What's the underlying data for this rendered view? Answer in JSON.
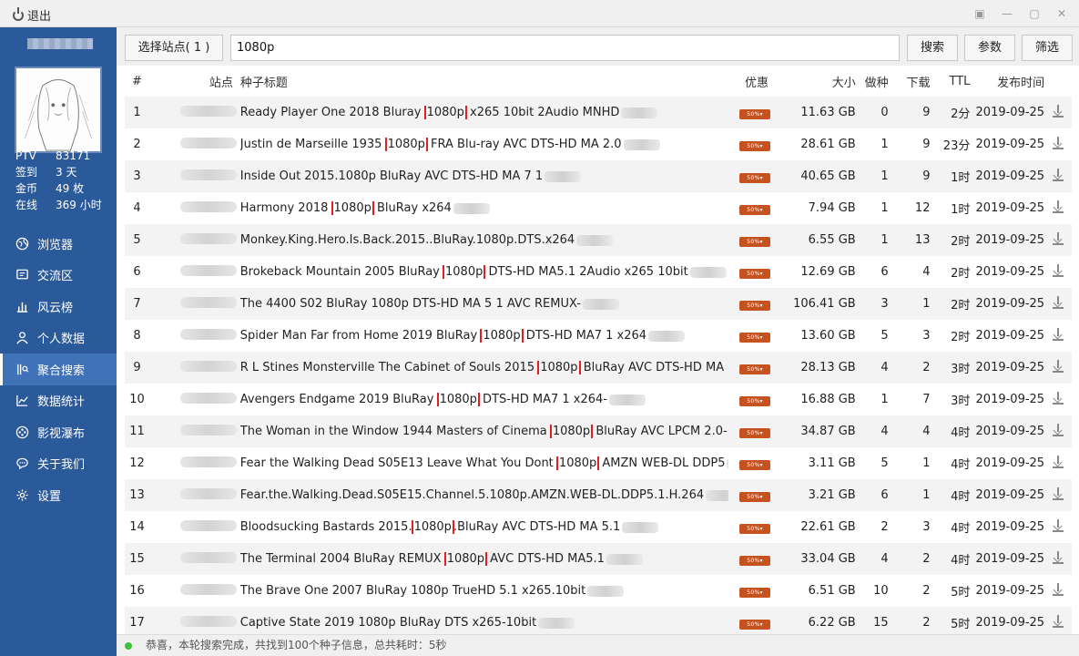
{
  "window": {
    "exit_label": "退出"
  },
  "sidebar": {
    "stats": [
      {
        "key": "PTV",
        "value": "83171"
      },
      {
        "key": "签到",
        "value": "3 天"
      },
      {
        "key": "金币",
        "value": "49 枚"
      },
      {
        "key": "在线",
        "value": "369 小时"
      }
    ],
    "nav": [
      {
        "label": "浏览器",
        "icon": "globe-icon",
        "active": false
      },
      {
        "label": "交流区",
        "icon": "chat-icon",
        "active": false
      },
      {
        "label": "风云榜",
        "icon": "bar-chart-icon",
        "active": false
      },
      {
        "label": "个人数据",
        "icon": "user-icon",
        "active": false
      },
      {
        "label": "聚合搜索",
        "icon": "aggregate-search-icon",
        "active": true
      },
      {
        "label": "数据统计",
        "icon": "line-chart-icon",
        "active": false
      },
      {
        "label": "影视瀑布",
        "icon": "film-icon",
        "active": false
      },
      {
        "label": "关于我们",
        "icon": "comment-icon",
        "active": false
      },
      {
        "label": "设置",
        "icon": "gear-icon",
        "active": false
      }
    ]
  },
  "toolbar": {
    "site_select_label": "选择站点( 1 )",
    "search_value": "1080p",
    "search_label": "搜索",
    "params_label": "参数",
    "filter_label": "筛选"
  },
  "table": {
    "headers": {
      "num": "#",
      "site": "站点",
      "title": "种子标题",
      "promo": "优惠",
      "size": "大小",
      "seed": "做种",
      "dl": "下载",
      "ttl": "TTL",
      "date": "发布时间"
    },
    "rows": [
      {
        "num": "1",
        "pre": "Ready Player One 2018 Bluray ",
        "hl": "1080p",
        "post": " x265 10bit 2Audio MNHD",
        "size": "11.63 GB",
        "seed": "0",
        "dl": "9",
        "ttl": "2分",
        "date": "2019-09-25"
      },
      {
        "num": "2",
        "pre": "Justin de Marseille 1935 ",
        "hl": "1080p",
        "post": " FRA Blu-ray AVC DTS-HD MA 2.0",
        "size": "28.61 GB",
        "seed": "1",
        "dl": "9",
        "ttl": "23分",
        "date": "2019-09-25"
      },
      {
        "num": "3",
        "pre": "Inside Out 2015.1080p BluRay AVC DTS-HD MA 7 1",
        "hl": "",
        "post": "",
        "size": "40.65 GB",
        "seed": "1",
        "dl": "9",
        "ttl": "1时",
        "date": "2019-09-25"
      },
      {
        "num": "4",
        "pre": "Harmony 2018 ",
        "hl": "1080p",
        "post": " BluRay x264",
        "size": "7.94 GB",
        "seed": "1",
        "dl": "12",
        "ttl": "1时",
        "date": "2019-09-25"
      },
      {
        "num": "5",
        "pre": "Monkey.King.Hero.Is.Back.2015..BluRay.1080p.DTS.x264",
        "hl": "",
        "post": "",
        "size": "6.55 GB",
        "seed": "1",
        "dl": "13",
        "ttl": "2时",
        "date": "2019-09-25"
      },
      {
        "num": "6",
        "pre": "Brokeback Mountain 2005 BluRay ",
        "hl": "1080p",
        "post": " DTS-HD MA5.1 2Audio x265 10bit",
        "size": "12.69 GB",
        "seed": "6",
        "dl": "4",
        "ttl": "2时",
        "date": "2019-09-25"
      },
      {
        "num": "7",
        "pre": "The 4400 S02 BluRay 1080p DTS-HD MA 5 1 AVC REMUX-",
        "hl": "",
        "post": "",
        "size": "106.41 GB",
        "seed": "3",
        "dl": "1",
        "ttl": "2时",
        "date": "2019-09-25"
      },
      {
        "num": "8",
        "pre": "Spider Man Far from Home 2019 BluRay ",
        "hl": "1080p",
        "post": " DTS-HD MA7 1 x264",
        "size": "13.60 GB",
        "seed": "5",
        "dl": "3",
        "ttl": "2时",
        "date": "2019-09-25"
      },
      {
        "num": "9",
        "pre": "R L Stines Monsterville The Cabinet of Souls 2015 ",
        "hl": "1080p",
        "post": " BluRay AVC DTS-HD MA 5",
        "size": "28.13 GB",
        "seed": "4",
        "dl": "2",
        "ttl": "3时",
        "date": "2019-09-25"
      },
      {
        "num": "10",
        "pre": "Avengers Endgame 2019 BluRay ",
        "hl": "1080p",
        "post": " DTS-HD MA7 1 x264-",
        "size": "16.88 GB",
        "seed": "1",
        "dl": "7",
        "ttl": "3时",
        "date": "2019-09-25"
      },
      {
        "num": "11",
        "pre": "The Woman in the Window 1944 Masters of Cinema ",
        "hl": "1080p",
        "post": " BluRay AVC LPCM 2.0-",
        "size": "34.87 GB",
        "seed": "4",
        "dl": "4",
        "ttl": "4时",
        "date": "2019-09-25"
      },
      {
        "num": "12",
        "pre": "Fear the Walking Dead S05E13 Leave What You Dont ",
        "hl": "1080p",
        "post": " AMZN WEB-DL DDP5",
        "size": "3.11 GB",
        "seed": "5",
        "dl": "1",
        "ttl": "4时",
        "date": "2019-09-25"
      },
      {
        "num": "13",
        "pre": "Fear.the.Walking.Dead.S05E15.Channel.5.1080p.AMZN.WEB-DL.DDP5.1.H.264",
        "hl": "",
        "post": "",
        "size": "3.21 GB",
        "seed": "6",
        "dl": "1",
        "ttl": "4时",
        "date": "2019-09-25"
      },
      {
        "num": "14",
        "pre": "Bloodsucking Bastards 2015.",
        "hl": "1080p",
        "post": ".BluRay AVC DTS-HD MA 5.1",
        "size": "22.61 GB",
        "seed": "2",
        "dl": "3",
        "ttl": "4时",
        "date": "2019-09-25"
      },
      {
        "num": "15",
        "pre": "The Terminal 2004 BluRay REMUX ",
        "hl": "1080p",
        "post": " AVC DTS-HD MA5.1",
        "size": "33.04 GB",
        "seed": "4",
        "dl": "2",
        "ttl": "4时",
        "date": "2019-09-25"
      },
      {
        "num": "16",
        "pre": "The Brave One 2007 BluRay 1080p TrueHD 5.1 x265.10bit",
        "hl": "",
        "post": "",
        "size": "6.51 GB",
        "seed": "10",
        "dl": "2",
        "ttl": "5时",
        "date": "2019-09-25"
      },
      {
        "num": "17",
        "pre": "Captive State 2019 1080p BluRay DTS x265-10bit",
        "hl": "",
        "post": "",
        "size": "6.22 GB",
        "seed": "15",
        "dl": "2",
        "ttl": "5时",
        "date": "2019-09-25"
      }
    ]
  },
  "status": {
    "message": "恭喜，本轮搜索完成，共找到100个种子信息，总共耗时：5秒"
  },
  "colors": {
    "sidebar": "#2b5a9b",
    "highlight": "#e02020",
    "promo": "#c6521f",
    "online": "#3cc13c"
  }
}
